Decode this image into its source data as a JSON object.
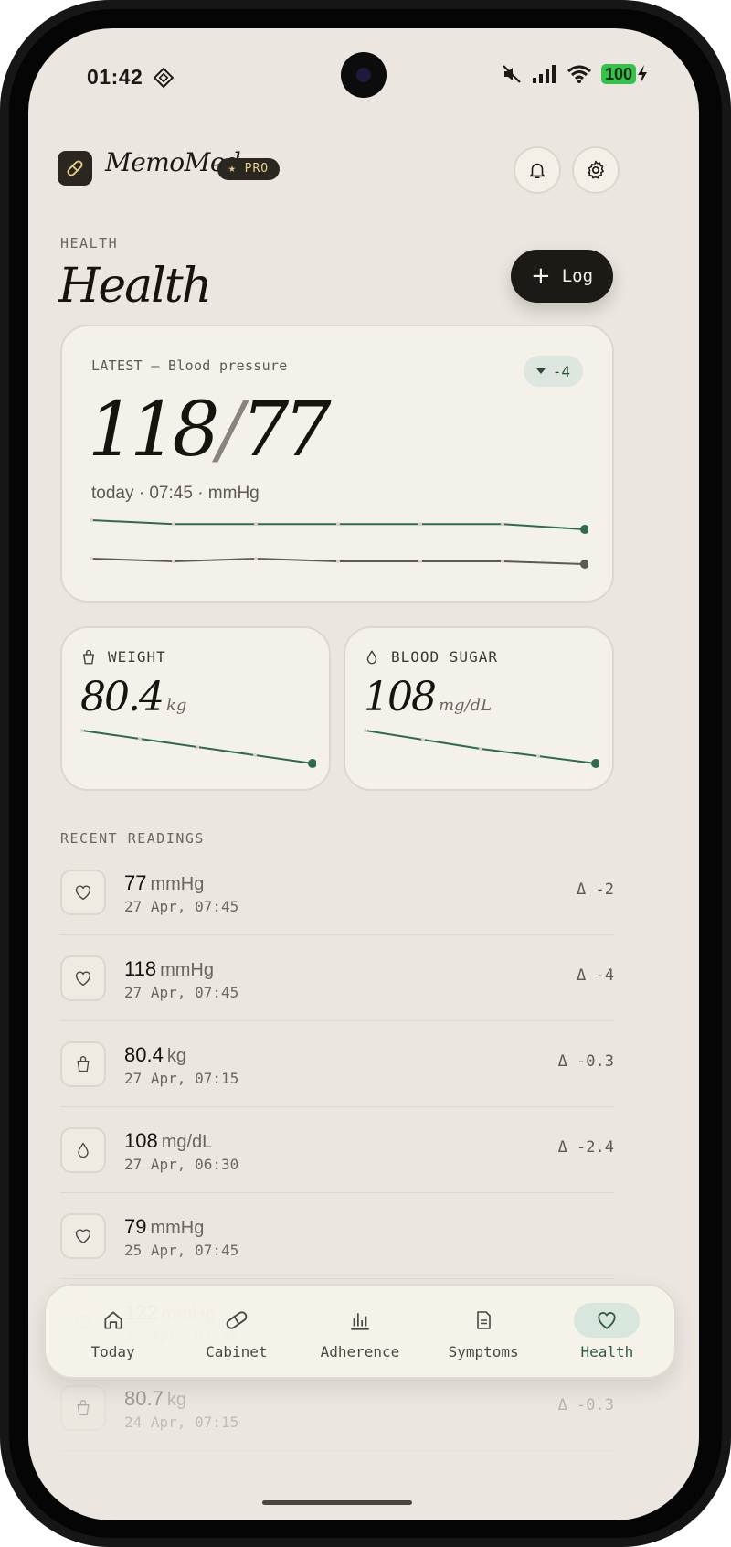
{
  "status_bar": {
    "time": "01:42",
    "battery": "100"
  },
  "header": {
    "app_name": "MemoMed",
    "badge": "PRO"
  },
  "page": {
    "eyebrow": "HEALTH",
    "title": "Health",
    "log_button": "Log"
  },
  "latest": {
    "label": "LATEST — Blood pressure",
    "delta": "-4",
    "systolic": "118",
    "diastolic": "77",
    "meta": "today · 07:45 · mmHg",
    "trend_systolic": [
      125,
      122,
      122,
      122,
      122,
      122,
      118
    ],
    "trend_diastolic": [
      79,
      78,
      79,
      78,
      78,
      78,
      77
    ]
  },
  "weight": {
    "label": "WEIGHT",
    "value": "80.4",
    "unit": "kg",
    "trend": [
      81.6,
      81.3,
      81.0,
      80.7,
      80.4
    ]
  },
  "sugar": {
    "label": "BLOOD SUGAR",
    "value": "108",
    "unit": "mg/dL",
    "trend": [
      117,
      114.5,
      112,
      110,
      108
    ]
  },
  "recent": {
    "label": "RECENT READINGS",
    "items": [
      {
        "icon": "heart-icon",
        "value": "77",
        "unit": "mmHg",
        "time": "27 Apr, 07:45",
        "delta": "Δ -2"
      },
      {
        "icon": "heart-icon",
        "value": "118",
        "unit": "mmHg",
        "time": "27 Apr, 07:45",
        "delta": "Δ -4"
      },
      {
        "icon": "weight-icon",
        "value": "80.4",
        "unit": "kg",
        "time": "27 Apr, 07:15",
        "delta": "Δ -0.3"
      },
      {
        "icon": "drop-icon",
        "value": "108",
        "unit": "mg/dL",
        "time": "27 Apr, 06:30",
        "delta": "Δ -2.4"
      },
      {
        "icon": "heart-icon",
        "value": "79",
        "unit": "mmHg",
        "time": "25 Apr, 07:45",
        "delta": ""
      },
      {
        "icon": "heart-icon",
        "value": "122",
        "unit": "mmHg",
        "time": "25 Apr, 07:45",
        "delta": ""
      },
      {
        "icon": "weight-icon",
        "value": "80.7",
        "unit": "kg",
        "time": "24 Apr, 07:15",
        "delta": "Δ -0.3"
      }
    ]
  },
  "nav": {
    "items": [
      {
        "label": "Today",
        "icon": "home-icon"
      },
      {
        "label": "Cabinet",
        "icon": "pill-icon"
      },
      {
        "label": "Adherence",
        "icon": "bar-chart-icon"
      },
      {
        "label": "Symptoms",
        "icon": "document-icon"
      },
      {
        "label": "Health",
        "icon": "heart-icon",
        "active": true
      }
    ]
  },
  "colors": {
    "accent": "#2f6b4f",
    "background": "#ebe6df",
    "card": "#f4f1ea",
    "dark": "#1b1a17"
  }
}
